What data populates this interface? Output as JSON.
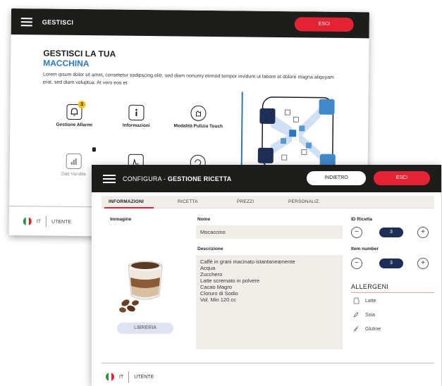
{
  "back": {
    "title": "GESTISCI",
    "exit_label": "ESCI",
    "heading_line1": "GESTISCI LA TUA",
    "heading_line2": "MACCHINA",
    "description": "Lorem ipsum dolor sit amet, consetetur sadipscing elitr, sed diam nonumy eirmod tempor invidunt ut labore et dolore magna aliquyam erat, sed diam voluptua. At vero eos et",
    "tiles": [
      {
        "label": "Gestione Allarmi",
        "icon": "bell-icon",
        "badge": "3"
      },
      {
        "label": "Informazioni",
        "icon": "info-icon"
      },
      {
        "label": "Modalità Pulizia Touch",
        "icon": "cleaning-hand-icon"
      },
      {
        "label": "Dati Vendite",
        "icon": "sales-chart-icon"
      },
      {
        "label": "",
        "icon": "touch-edit-icon"
      },
      {
        "label": "",
        "icon": "refresh-icon"
      }
    ],
    "footer": {
      "lang": "IT",
      "user": "UTENTE"
    }
  },
  "front": {
    "title_prefix": "CONFIGURA - ",
    "title_bold": "GESTIONE RICETTA",
    "back_label": "INDIETRO",
    "exit_label": "ESCI",
    "tabs": [
      "INFORMAZIONI",
      "RICETTA",
      "PREZZI",
      "PERSONALIZ."
    ],
    "image_label": "Immagine",
    "library_label": "LIBRERIA",
    "name_label": "Nome",
    "name_value": "Mocaccino",
    "desc_label": "Descrizione",
    "desc_lines": [
      "Caffè in grani macinato istantaneamente",
      "Acqua",
      "Zucchero",
      "Latte scremato in polvere",
      "Cacao Magro",
      "Cloruro di Sodio",
      "Vol. Min 120 cc"
    ],
    "recipe_id_label": "ID Ricetta",
    "recipe_id_value": "3",
    "item_number_label": "Item number",
    "item_number_value": "3",
    "allergens_title": "ALLERGENI",
    "allergens": [
      {
        "label": "Latte",
        "icon": "milk-icon"
      },
      {
        "label": "Soia",
        "icon": "soy-icon"
      },
      {
        "label": "Glutine",
        "icon": "wheat-icon"
      }
    ],
    "footer": {
      "lang": "IT",
      "user": "UTENTE"
    }
  },
  "colors": {
    "accent_red": "#e32233",
    "accent_blue": "#2a79c2",
    "navy": "#1e2f57",
    "dark": "#1d1d1b"
  }
}
